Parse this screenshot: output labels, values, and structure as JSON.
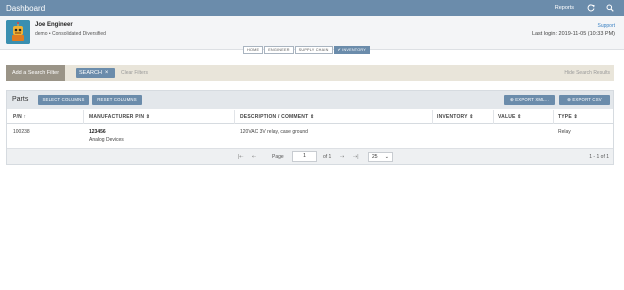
{
  "topbar": {
    "title": "Dashboard",
    "reports": "Reports",
    "icons": [
      "refresh-icon",
      "search-icon"
    ]
  },
  "user": {
    "name": "Joe Engineer",
    "company": "demo • Consolidated Diversified",
    "support": "Support",
    "last_login": "Last login: 2019-11-05 (10:33 PM)"
  },
  "tabs": [
    {
      "label": "HOME",
      "active": false
    },
    {
      "label": "ENGINEER",
      "active": false
    },
    {
      "label": "SUPPLY CHAIN",
      "active": false
    },
    {
      "label": "✔ INVENTORY",
      "active": true
    }
  ],
  "filter": {
    "add_filter": "Add a Search Filter",
    "search": "SEARCH",
    "clear": "Clear Filters",
    "hide": "Hide Search Results"
  },
  "panel": {
    "title": "Parts",
    "select_columns": "SELECT COLUMNS",
    "reset_columns": "RESET COLUMNS",
    "export_xml": "EXPORT XML...",
    "export_csv": "EXPORT CSV",
    "columns": {
      "pn": "P/N ↑",
      "mpn": "MANUFACTURER P/N",
      "desc": "DESCRIPTION / COMMENT",
      "inventory": "INVENTORY",
      "value": "VALUE",
      "type": "TYPE"
    },
    "sort_glyph": "⇕",
    "rows": [
      {
        "pn": "100238",
        "mpn": "123456",
        "manufacturer": "Analog Devices",
        "desc": "120VAC 3V relay, case ground",
        "inventory": "",
        "value": "",
        "type": "Relay"
      }
    ]
  },
  "pager": {
    "first": "|⇠",
    "prev": "⇠",
    "page_label": "Page",
    "page": "1",
    "of": "of 1",
    "next": "⇢",
    "last": "⇢|",
    "per_page": "25",
    "range": "1 - 1 of 1"
  },
  "colors": {
    "accent": "#6b8cab",
    "filter_bg": "#e9e5da",
    "add_filter_bg": "#9a9487"
  }
}
